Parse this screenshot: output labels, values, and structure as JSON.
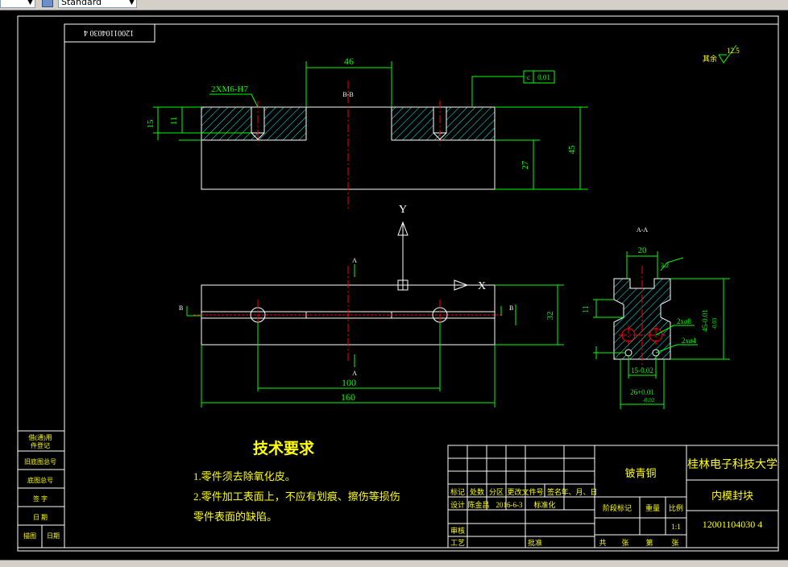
{
  "toolbar": {
    "combo1_value": "",
    "style_value": "Standard"
  },
  "drawing": {
    "part_number_mirrored": "12001104030 4",
    "surface_finish_value": "12.5",
    "surface_finish_label": "其余",
    "top_view": {
      "dim_46": "46",
      "hole_callout": "2XM6-H7",
      "section_label": "B-B",
      "flatness": "0.01",
      "dim_15": "15",
      "dim_11": "11",
      "dim_27": "27",
      "dim_45": "45"
    },
    "axis": {
      "y": "Y",
      "x": "X"
    },
    "plan_view": {
      "dim_100": "100",
      "dim_160": "160",
      "dim_32": "32",
      "label_a": "A",
      "label_b": "B"
    },
    "section_view": {
      "title": "A-A",
      "dim_20": "20",
      "dim_3_2": "3.2",
      "dim_11": "11",
      "hole_1": "2xø8",
      "hole_2": "2xø4",
      "dim_45_tol": "45-0.01",
      "dim_45_tol2": "-0.03",
      "dim_15": "15-0.02",
      "dim_26": "26+0.01",
      "dim_26b": "-0.02"
    },
    "tech_req": {
      "title": "技术要求",
      "line1": "1.零件须去除氧化皮。",
      "line2": "2.零件加工表面上，不应有划痕、擦伤等损伤",
      "line3": "零件表面的缺陷。"
    },
    "side_table": [
      {
        "a": "借(通)用",
        "b": "件登记"
      },
      {
        "a": "旧底图总号",
        "b": ""
      },
      {
        "a": "底图总号",
        "b": ""
      },
      {
        "a": "签  字",
        "b": ""
      },
      {
        "a": "日  期",
        "b": ""
      },
      {
        "a": "描图",
        "b": "日期"
      }
    ],
    "title_block": {
      "material": "铍青铜",
      "school": "桂林电子科技大学",
      "part_name": "内模封块",
      "drawing_no": "12001104030 4",
      "scale": "1:1",
      "row_labels": [
        "标记",
        "处数",
        "分区",
        "更改文件号",
        "签名",
        "年、月、日"
      ],
      "designer_label": "设计",
      "designer": "陈金昌",
      "date": "2016-6-3",
      "std_label": "标准化",
      "stage_label": "阶段标记",
      "weight_label": "重量",
      "scale_label": "比例",
      "review_label": "审核",
      "process_label": "工艺",
      "approve_label": "批准",
      "sheets": "共",
      "sheet": "张",
      "page": "第",
      "page2": "张"
    }
  }
}
